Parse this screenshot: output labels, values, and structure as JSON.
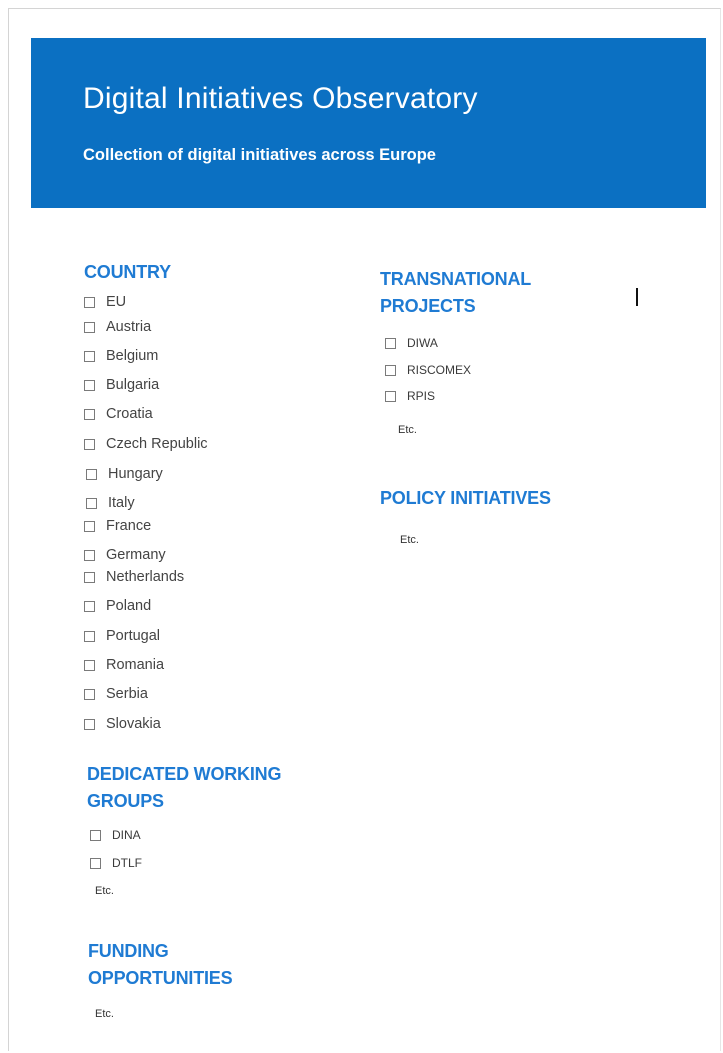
{
  "header": {
    "title": "Digital Initiatives Observatory",
    "subtitle": "Collection of digital initiatives across Europe"
  },
  "country": {
    "heading": "COUNTRY",
    "items": [
      "EU",
      "Austria",
      "Belgium",
      "Bulgaria",
      "Croatia",
      "Czech Republic",
      "Hungary",
      "Italy",
      "France",
      "Germany",
      "Netherlands",
      "Poland",
      "Portugal",
      "Romania",
      "Serbia",
      "Slovakia"
    ]
  },
  "working_groups": {
    "heading_line1": "DEDICATED WORKING",
    "heading_line2": "GROUPS",
    "items": [
      "DINA",
      "DTLF"
    ],
    "etc": "Etc."
  },
  "funding": {
    "heading_line1": "FUNDING",
    "heading_line2": "OPPORTUNITIES",
    "etc": "Etc."
  },
  "transnational": {
    "heading_line1": "TRANSNATIONAL",
    "heading_line2": "PROJECTS",
    "items": [
      "DIWA",
      "RISCOMEX",
      "RPIS"
    ],
    "etc": "Etc."
  },
  "policy": {
    "heading": "POLICY INITIATIVES",
    "etc": "Etc."
  },
  "colors": {
    "banner": "#0b70c2",
    "heading": "#1f7bd3"
  }
}
